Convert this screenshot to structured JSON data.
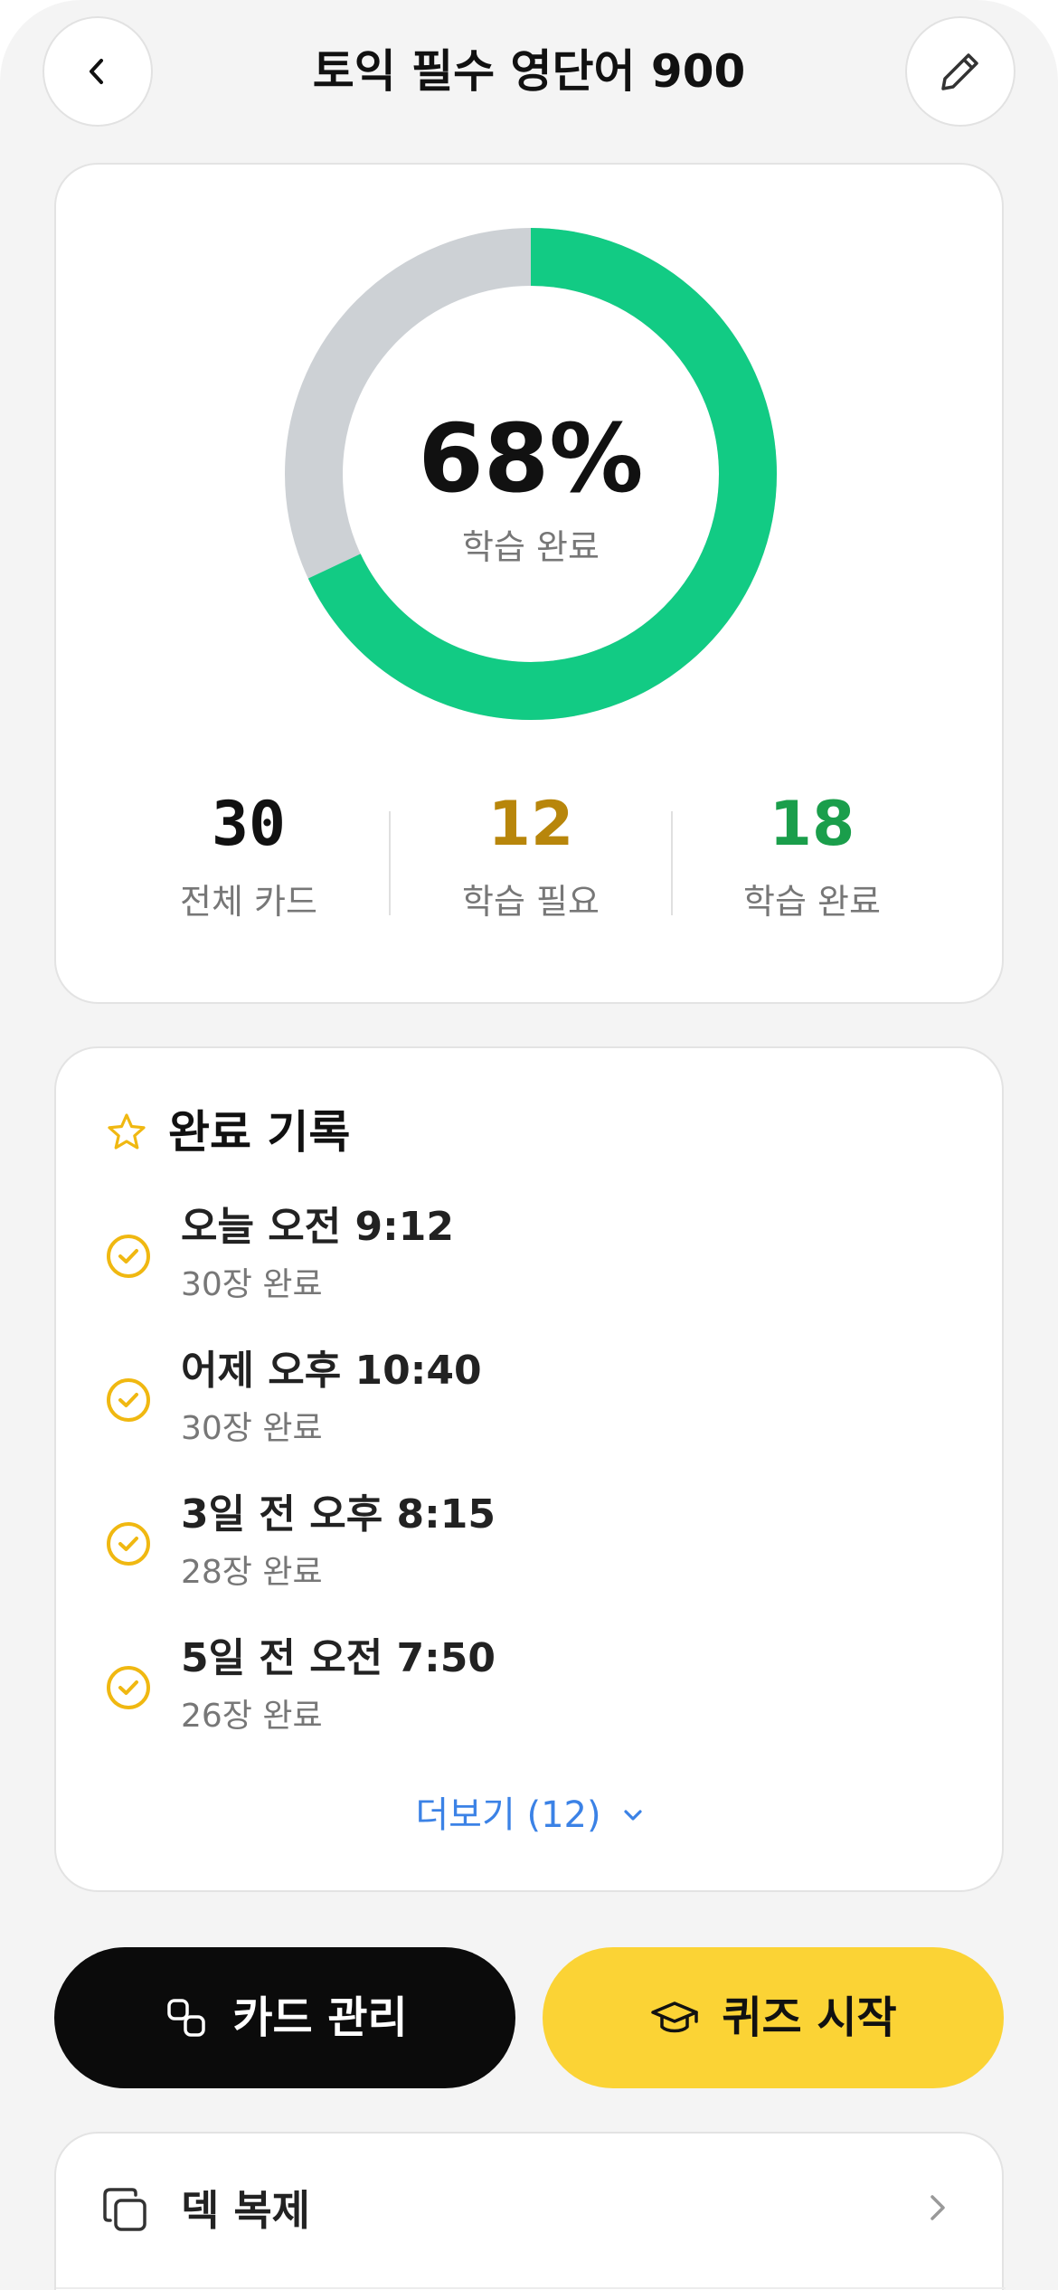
{
  "header": {
    "title": "토익 필수 영단어 900",
    "back_icon": "chevron-left-icon",
    "edit_icon": "pencil-icon"
  },
  "progress": {
    "percent_text": "68%",
    "percent_value": 68,
    "label": "학습 완료",
    "colors": {
      "done": "#12cb84",
      "remaining": "#cdd1d5"
    }
  },
  "stats": [
    {
      "value": "30",
      "label": "전체 카드",
      "color": "#111111"
    },
    {
      "value": "12",
      "label": "학습 필요",
      "color": "#b8860b"
    },
    {
      "value": "18",
      "label": "학습 완료",
      "color": "#1a9e4b"
    }
  ],
  "history": {
    "title": "완료 기록",
    "title_icon": "star-icon",
    "entries": [
      {
        "when": "오늘 오전 9:12",
        "count": "30장 완료"
      },
      {
        "when": "어제 오후 10:40",
        "count": "30장 완료"
      },
      {
        "when": "3일 전 오후 8:15",
        "count": "28장 완료"
      },
      {
        "when": "5일 전 오전 7:50",
        "count": "26장 완료"
      }
    ],
    "more_label": "더보기 (12)",
    "accent": "#f0b811"
  },
  "actions": {
    "manage_label": "카드 관리",
    "quiz_label": "퀴즈 시작"
  },
  "menu": {
    "items": [
      {
        "label": "덱 복제",
        "icon": "copy-icon"
      }
    ]
  }
}
